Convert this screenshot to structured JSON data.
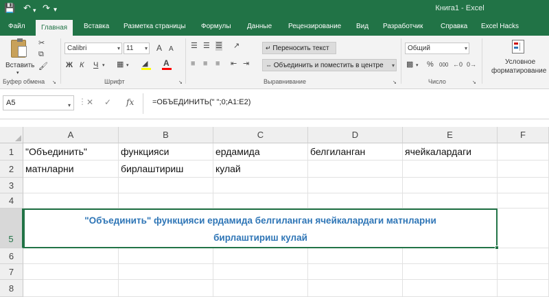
{
  "window": {
    "title": "Книга1  -  Excel"
  },
  "quick_access": {
    "save_icon": "save-icon",
    "undo_icon": "undo-icon",
    "redo_icon": "redo-icon",
    "customize_icon": "customize-qa-icon"
  },
  "menu": {
    "tabs": [
      "Файл",
      "Главная",
      "Вставка",
      "Разметка страницы",
      "Формулы",
      "Данные",
      "Рецензирование",
      "Вид",
      "Разработчик",
      "Справка",
      "Excel Hacks"
    ],
    "active": "Главная"
  },
  "ribbon": {
    "clipboard": {
      "paste_label": "Вставить",
      "group_label": "Буфер обмена"
    },
    "font": {
      "name": "Calibri",
      "size": "11",
      "bold": "Ж",
      "italic": "К",
      "underline": "Ч",
      "grow": "A",
      "shrink": "A",
      "group_label": "Шрифт"
    },
    "alignment": {
      "wrap_label": "Переносить текст",
      "merge_label": "Объединить и поместить в центре",
      "group_label": "Выравнивание"
    },
    "number": {
      "format": "Общий",
      "percent": "%",
      "thousands": "000",
      "group_label": "Число"
    },
    "styles": {
      "conditional_label_1": "Условное",
      "conditional_label_2": "форматирование"
    }
  },
  "formula_bar": {
    "name_box": "A5",
    "fx": "fx",
    "formula": "=ОБЪЕДИНИТЬ(\" \";0;A1:E2)"
  },
  "sheet": {
    "columns": [
      "A",
      "B",
      "C",
      "D",
      "E",
      "F"
    ],
    "rows": [
      "1",
      "2",
      "3",
      "4",
      "5",
      "6",
      "7",
      "8"
    ],
    "row1": [
      "\"Объединить\"",
      "функцияси",
      "ердамида",
      "белгиланган",
      "ячейкалардаги",
      ""
    ],
    "row2": [
      "матнларни",
      "бирлаштириш",
      "кулай",
      "",
      "",
      ""
    ],
    "merged_line1": "\"Объединить\"  функцияси ердамида белгиланган ячейкалардаги матнларни",
    "merged_line2": "бирлаштириш кулай"
  },
  "colors": {
    "excel_green": "#217346",
    "result_text": "#2e75b6"
  }
}
